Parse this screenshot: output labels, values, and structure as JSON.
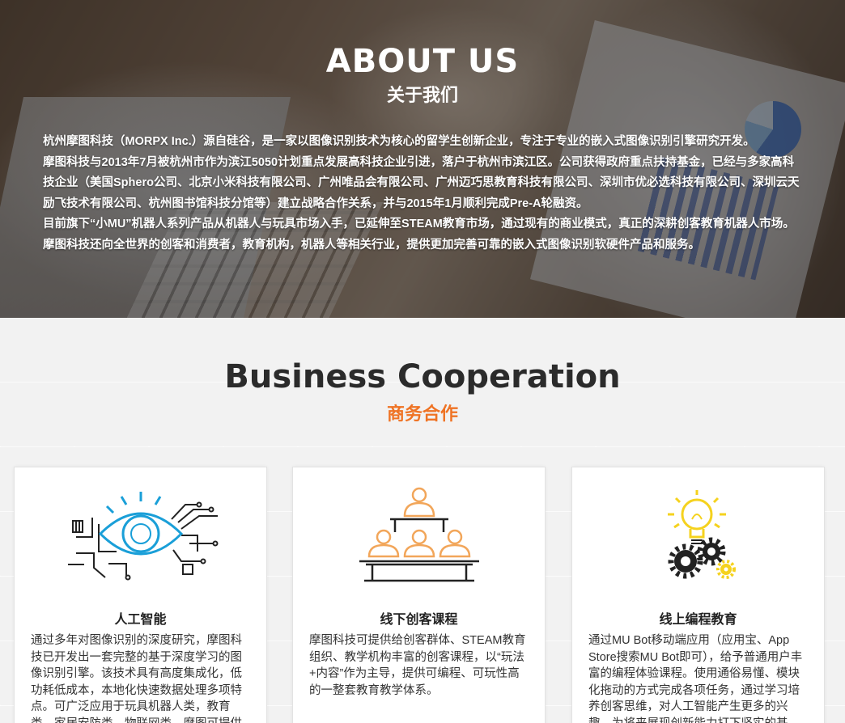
{
  "about": {
    "title": "ABOUT US",
    "subtitle": "关于我们",
    "paragraphs": [
      "杭州摩图科技（MORPX Inc.）源自硅谷，是一家以图像识别技术为核心的留学生创新企业，专注于专业的嵌入式图像识别引擎研究开发。",
      "摩图科技与2013年7月被杭州市作为滨江5050计划重点发展高科技企业引进，落户于杭州市滨江区。公司获得政府重点扶持基金，已经与多家高科技企业（美国Sphero公司、北京小米科技有限公司、广州唯品会有限公司、广州迈巧思教育科技有限公司、深圳市优必选科技有限公司、深圳云天励飞技术有限公司、杭州图书馆科技分馆等）建立战略合作关系，并与2015年1月顺利完成Pre-A轮融资。",
      "目前旗下“小MU”机器人系列产品从机器人与玩具市场入手，已延伸至STEAM教育市场，通过现有的商业模式，真正的深耕创客教育机器人市场。摩图科技还向全世界的创客和消费者，教育机构，机器人等相关行业，提供更加完善可靠的嵌入式图像识别软硬件产品和服务。"
    ]
  },
  "business": {
    "title": "Business Cooperation",
    "subtitle": "商务合作",
    "cards": [
      {
        "icon": "ai-eye-circuit-icon",
        "title": "人工智能",
        "desc": "通过多年对图像识别的深度研究，摩图科技已开发出一套完整的基于深度学习的图像识别引擎。该技术具有高度集成化，低功耗低成本，本地化快速数据处理多项特点。可广泛应用于玩具机器人类，教育类，家居安防类，物联网类，摩图可提供"
      },
      {
        "icon": "classroom-people-icon",
        "title": "线下创客课程",
        "desc": "摩图科技可提供给创客群体、STEAM教育组织、教学机构丰富的创客课程，以“玩法+内容”作为主导，提供可编程、可玩性高的一整套教育教学体系。"
      },
      {
        "icon": "lightbulb-gears-icon",
        "title": "线上编程教育",
        "desc": "通过MU Bot移动端应用（应用宝、App Store搜索MU Bot即可），给予普通用户丰富的编程体验课程。使用通俗易懂、模块化拖动的方式完成各项任务，通过学习培养创客思维，对人工智能产生更多的兴趣，为将来展现创新能力打下坚实的基"
      }
    ]
  },
  "colors": {
    "accent": "#ef7324",
    "icon_blue": "#1a9fd8",
    "icon_orange": "#f2a65a",
    "icon_yellow": "#f5d21e",
    "dark": "#222222"
  }
}
